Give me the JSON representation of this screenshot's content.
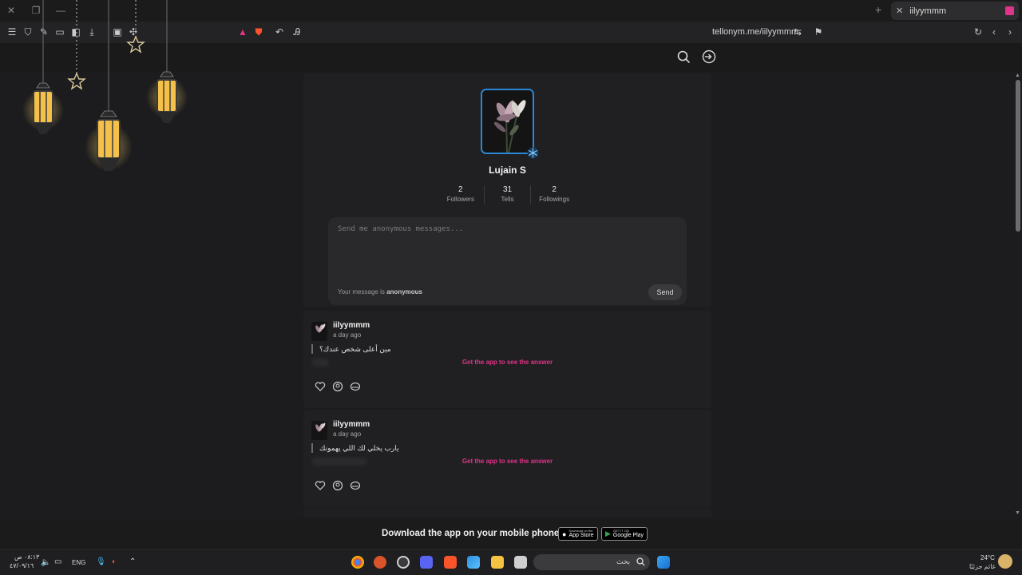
{
  "browser": {
    "tab_title": "iilyymmm",
    "url": "tellonym.me/iilyymmm"
  },
  "profile": {
    "name": "Lujain S",
    "stats": [
      {
        "value": "2",
        "label": "Followers"
      },
      {
        "value": "31",
        "label": "Tells"
      },
      {
        "value": "2",
        "label": "Followings"
      }
    ]
  },
  "compose": {
    "placeholder": "Send me anonymous messages...",
    "note_prefix": "Your message is",
    "note_strong": "anonymous",
    "send_label": "Send"
  },
  "tells": [
    {
      "user": "iilyymmm",
      "time": "a day ago",
      "question": "مين أعلى شخص عندك؟",
      "cta": "Get the app to see the answer"
    },
    {
      "user": "iilyymmm",
      "time": "a day ago",
      "question": "يارب يخلي لك اللي يهمونك",
      "cta": "Get the app to see the answer"
    }
  ],
  "banner": {
    "text": "Download the app on your mobile phone",
    "app_store_small": "Download on the",
    "app_store_big": "App Store",
    "google_play_small": "GET IT ON",
    "google_play_big": "Google Play"
  },
  "taskbar": {
    "time": "٠٨:١٣ ص",
    "date": "٤٧/٠٩/١٦",
    "lang": "ENG",
    "search_placeholder": "بحث",
    "weather_temp": "24°C",
    "weather_desc": "غائم جزئيًا"
  },
  "colors": {
    "accent_pink": "#e0338a",
    "avatar_border": "#2a88d6",
    "page_bg": "#1c1c1e",
    "card_bg": "#202022"
  }
}
